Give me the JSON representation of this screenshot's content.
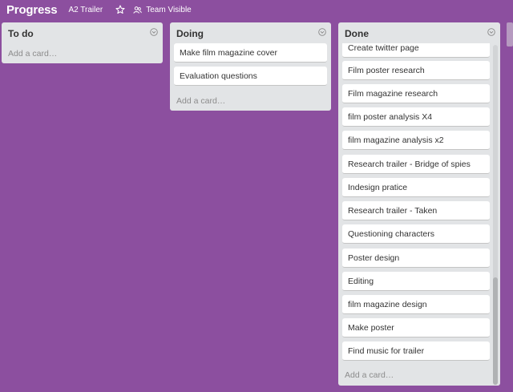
{
  "header": {
    "board_name": "Progress",
    "org_name": "A2 Trailer",
    "visibility": "Team Visible"
  },
  "lists": {
    "todo": {
      "title": "To do",
      "add_card": "Add a card…",
      "cards": []
    },
    "doing": {
      "title": "Doing",
      "add_card": "Add a card…",
      "cards": [
        "Make film magazine cover",
        "Evaluation questions"
      ]
    },
    "done": {
      "title": "Done",
      "add_card": "Add a card…",
      "cards": [
        "Create twitter page",
        "Film poster research",
        "Film magazine research",
        "film poster analysis X4",
        "film magazine analysis x2",
        "Research trailer - Bridge of spies",
        "Indesign pratice",
        "Research trailer - Taken",
        "Questioning characters",
        "Poster design",
        "Editing",
        "film magazine design",
        "Make poster",
        "Find music for trailer"
      ]
    }
  },
  "colors": {
    "board_background": "#8c4f9f",
    "list_background": "#e2e4e6",
    "card_background": "#ffffff"
  }
}
